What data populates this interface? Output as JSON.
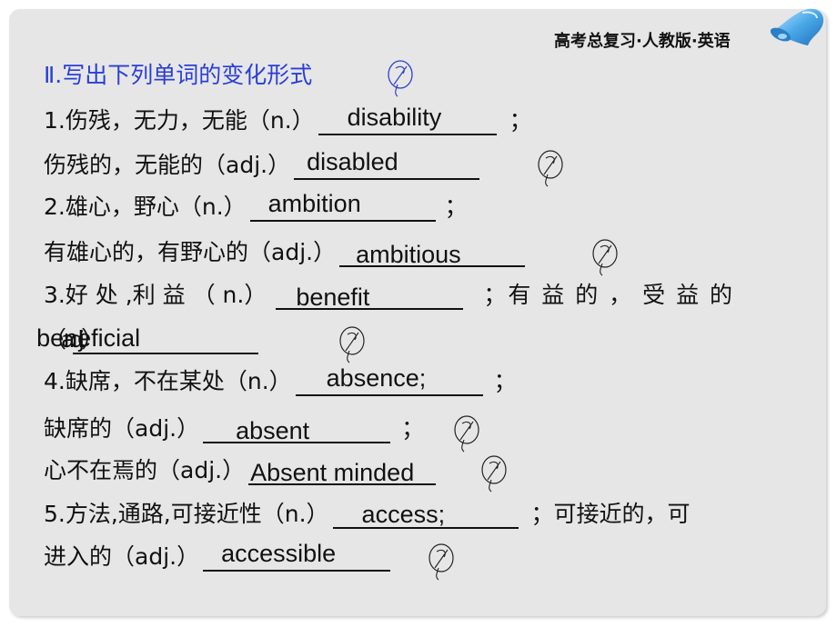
{
  "header": {
    "title": "高考总复习·人教版·英语",
    "icon": "bell-icon",
    "icon_color": "#4aa8e8"
  },
  "section": {
    "title": "Ⅱ.写出下列单词的变化形式",
    "color": "#2a3fd6"
  },
  "items": [
    {
      "prompt": "1.伤残，无力，无能（n.）",
      "answer": "disability",
      "suffix": "；"
    },
    {
      "prompt": "伤残的，无能的（adj.）",
      "answer": "disabled",
      "suffix": ""
    },
    {
      "prompt": "2.雄心，野心（n.）",
      "answer": "ambition",
      "suffix": "；"
    },
    {
      "prompt": "有雄心的，有野心的（adj.）",
      "answer": "ambitious",
      "suffix": ""
    },
    {
      "prompt": "3.好 处 ,利 益 （ n.）",
      "answer": "benefit",
      "suffix": "；有 益 的 ， 受 益 的"
    },
    {
      "prompt": "（adj.）",
      "answer": "beneficial",
      "suffix": ""
    },
    {
      "prompt": "4.缺席，不在某处（n.）",
      "answer": "absence;",
      "suffix": "；"
    },
    {
      "prompt": "缺席的（adj.）",
      "answer": "absent",
      "suffix": "；"
    },
    {
      "prompt": "心不在焉的（adj.）",
      "answer": "Absent minded",
      "suffix": ""
    },
    {
      "prompt": "5.方法,通路,可接近性（n.）",
      "answer": "access;",
      "suffix": "；可接近的，可"
    },
    {
      "prompt": "进入的（adj.）",
      "answer": "accessible",
      "suffix": ""
    }
  ],
  "annotation": {
    "icon": "handwritten-circle-mark-icon",
    "section_color": "#3040c8",
    "item_color": "#222222"
  }
}
